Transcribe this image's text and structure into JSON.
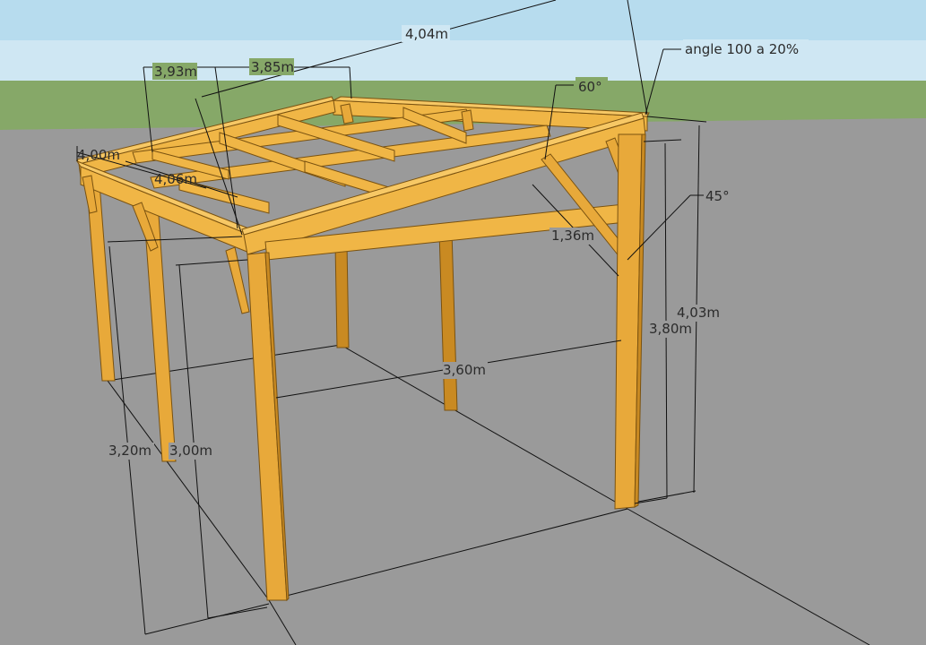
{
  "colors": {
    "sky": "#cfe7f3",
    "grass": "#86a868",
    "ground": "#9a9a9a",
    "wood": "#e8a93a",
    "wood_light": "#f7c865",
    "wood_dark": "#c98a22",
    "dimension_line": "#111111"
  },
  "dimensions": {
    "total_length": "4,04m",
    "length_a": "3,93m",
    "length_b": "3,85m",
    "depth_a": "4,00m",
    "depth_b": "4,06m",
    "width": "3,60m",
    "brace": "1,36m",
    "height_front_outer": "3,20m",
    "height_front_inner": "3,00m",
    "height_back_inner": "3,80m",
    "height_back_outer": "4,03m"
  },
  "annotations": {
    "roof_angle": "angle 100 a 20%",
    "angle_60": "60°",
    "angle_45": "45°"
  }
}
